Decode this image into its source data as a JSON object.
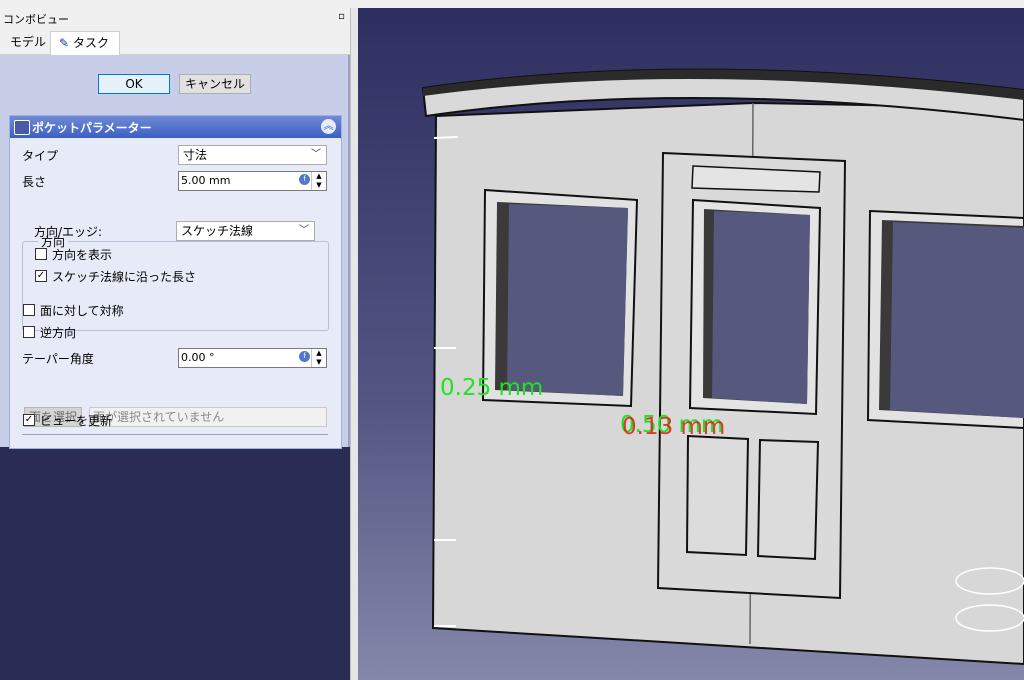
{
  "combo_view": {
    "title": "コンボビュー",
    "undock_icon": "undock-icon",
    "tabs": [
      {
        "label": "モデル",
        "active": false
      },
      {
        "label": "タスク",
        "active": true,
        "icon": "pencil-icon"
      }
    ]
  },
  "dialog": {
    "ok_label": "OK",
    "cancel_label": "キャンセル"
  },
  "pocket_params": {
    "title": "ポケットパラメーター",
    "icon": "pocket-icon",
    "collapse_icon": "chevron-up-icon",
    "type_label": "タイプ",
    "type_value": "寸法",
    "length_label": "長さ",
    "length_value": "5.00 mm",
    "direction_group": "方向",
    "direction_edge_label": "方向/エッジ:",
    "direction_edge_value": "スケッチ法線",
    "show_direction_label": "方向を表示",
    "show_direction_checked": false,
    "along_normal_label": "スケッチ法線に沿った長さ",
    "along_normal_checked": true,
    "symmetric_label": "面に対して対称",
    "symmetric_checked": false,
    "reversed_label": "逆方向",
    "reversed_checked": false,
    "taper_label": "テーパー角度",
    "taper_value": "0.00 °",
    "select_face_label": "面を選択",
    "face_placeholder": "面が選択されていません",
    "update_view_label": "ビューを更新",
    "update_view_checked": true
  },
  "view3d": {
    "dimension_labels": [
      "0.25 mm",
      "0.50 mm",
      "0.13 mm"
    ],
    "dimension_color": "#1fe41f",
    "dimension_alt_color": "#e01c1c"
  },
  "colors": {
    "accent": "#3c5fc4",
    "panel_bg": "#2b2c56",
    "model_face": "#d7d7d7"
  }
}
